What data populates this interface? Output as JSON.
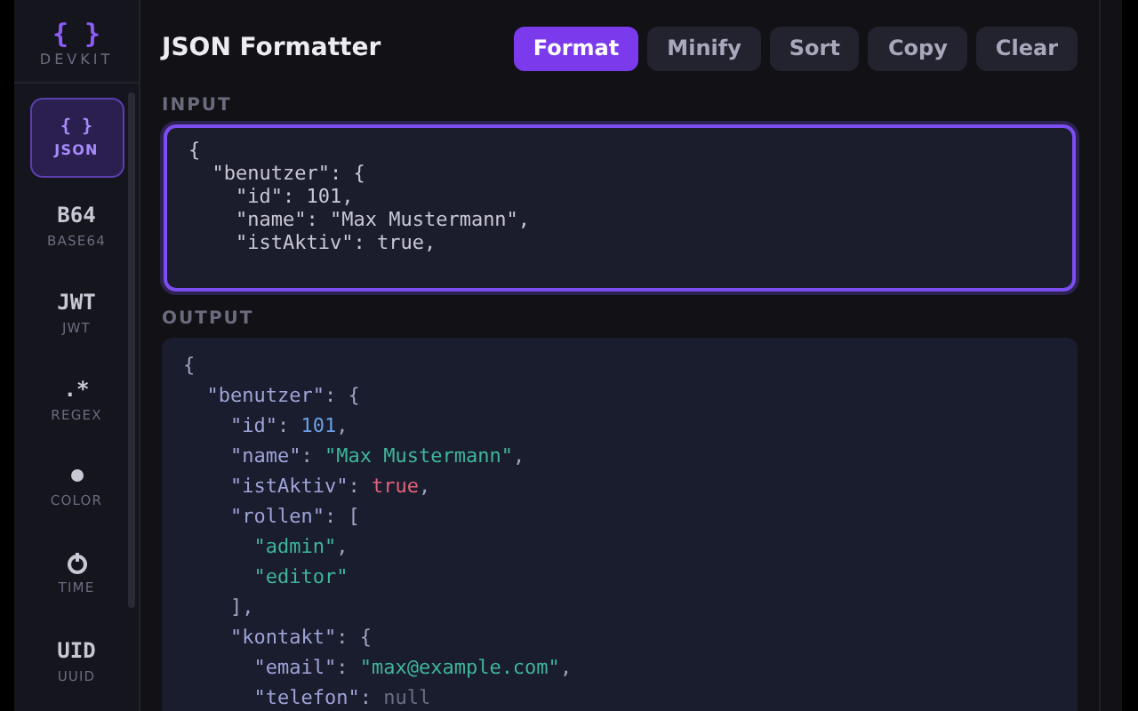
{
  "sidebar": {
    "logo": {
      "glyph": "{ }",
      "name": "DEVKIT"
    },
    "items": [
      {
        "kind": "glyph",
        "glyph": "{ }",
        "label": "JSON",
        "selected": true
      },
      {
        "kind": "glyph",
        "glyph": "B64",
        "label": "BASE64",
        "selected": false
      },
      {
        "kind": "glyph",
        "glyph": "JWT",
        "label": "JWT",
        "selected": false
      },
      {
        "kind": "glyph",
        "glyph": ".*",
        "label": "REGEX",
        "selected": false
      },
      {
        "kind": "dot",
        "label": "COLOR",
        "selected": false
      },
      {
        "kind": "clock",
        "label": "TIME",
        "selected": false
      },
      {
        "kind": "glyph",
        "glyph": "UID",
        "label": "UUID",
        "selected": false
      }
    ]
  },
  "header": {
    "title": "JSON Formatter",
    "buttons": [
      {
        "label": "Format",
        "primary": true
      },
      {
        "label": "Minify",
        "primary": false
      },
      {
        "label": "Sort",
        "primary": false
      },
      {
        "label": "Copy",
        "primary": false
      },
      {
        "label": "Clear",
        "primary": false
      }
    ]
  },
  "input": {
    "label": "INPUT",
    "lines": [
      "{",
      "  \"benutzer\": {",
      "    \"id\": 101,",
      "    \"name\": \"Max Mustermann\",",
      "    \"istAktiv\": true,"
    ]
  },
  "output": {
    "label": "OUTPUT",
    "lines": [
      [
        {
          "kind": "punct",
          "text": "{"
        }
      ],
      [
        {
          "kind": "key",
          "text": "  \"benutzer\""
        },
        {
          "kind": "punct",
          "text": ": {"
        }
      ],
      [
        {
          "kind": "key",
          "text": "    \"id\""
        },
        {
          "kind": "punct",
          "text": ": "
        },
        {
          "kind": "number",
          "text": "101"
        },
        {
          "kind": "punct",
          "text": ","
        }
      ],
      [
        {
          "kind": "key",
          "text": "    \"name\""
        },
        {
          "kind": "punct",
          "text": ": "
        },
        {
          "kind": "string",
          "text": "\"Max Mustermann\""
        },
        {
          "kind": "punct",
          "text": ","
        }
      ],
      [
        {
          "kind": "key",
          "text": "    \"istAktiv\""
        },
        {
          "kind": "punct",
          "text": ": "
        },
        {
          "kind": "bool",
          "text": "true"
        },
        {
          "kind": "punct",
          "text": ","
        }
      ],
      [
        {
          "kind": "key",
          "text": "    \"rollen\""
        },
        {
          "kind": "punct",
          "text": ": ["
        }
      ],
      [
        {
          "kind": "string",
          "text": "      \"admin\""
        },
        {
          "kind": "punct",
          "text": ","
        }
      ],
      [
        {
          "kind": "string",
          "text": "      \"editor\""
        }
      ],
      [
        {
          "kind": "punct",
          "text": "    ],"
        }
      ],
      [
        {
          "kind": "key",
          "text": "    \"kontakt\""
        },
        {
          "kind": "punct",
          "text": ": {"
        }
      ],
      [
        {
          "kind": "key",
          "text": "      \"email\""
        },
        {
          "kind": "punct",
          "text": ": "
        },
        {
          "kind": "string",
          "text": "\"max@example.com\""
        },
        {
          "kind": "punct",
          "text": ","
        }
      ],
      [
        {
          "kind": "key",
          "text": "      \"telefon\""
        },
        {
          "kind": "punct",
          "text": ": "
        },
        {
          "kind": "null",
          "text": "null"
        }
      ]
    ]
  }
}
